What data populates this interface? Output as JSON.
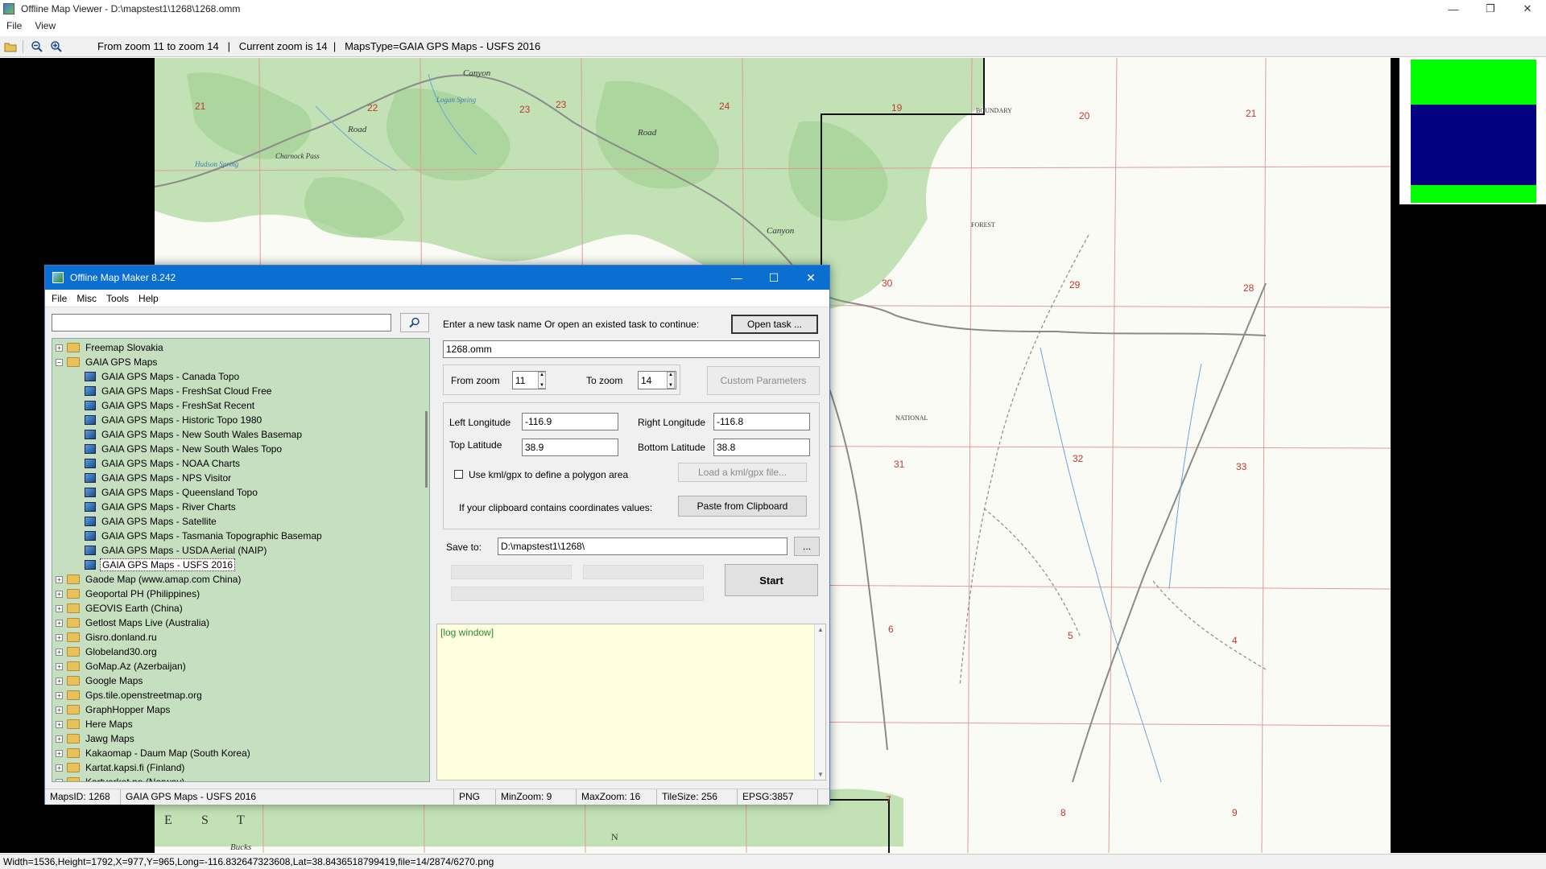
{
  "window": {
    "title": "Offline Map Viewer - D:\\mapstest1\\1268\\1268.omm",
    "controls": [
      "—",
      "❐",
      "✕"
    ]
  },
  "menubar": [
    "File",
    "View"
  ],
  "toolbar": {
    "status": "From zoom 11 to zoom 14   |   Current zoom is 14  |   MapsType=GAIA GPS Maps - USFS 2016"
  },
  "map": {
    "labels": [
      "21",
      "22",
      "23",
      "23",
      "24",
      "19",
      "20",
      "21",
      "30",
      "29",
      "28",
      "31",
      "32",
      "33",
      "6",
      "5",
      "4",
      "7",
      "8",
      "9"
    ],
    "place_labels": [
      "Canyon",
      "Road",
      "Road",
      "Canyon",
      "Charnock Pass",
      "Logan Spring",
      "Hudson Spring",
      "BOUNDARY",
      "NATIONAL",
      "FOREST",
      "Bucks",
      "E",
      "S",
      "T",
      "N"
    ]
  },
  "bottom_status": "Width=1536,Height=1792,X=977,Y=965,Long=-116.832647323608,Lat=38.8436518799419,file=14/2874/6270.png",
  "dialog": {
    "title": "Offline Map Maker 8.242",
    "menu": [
      "File",
      "Misc",
      "Tools",
      "Help"
    ],
    "search_value": "",
    "tree": [
      {
        "label": "Freemap Slovakia",
        "type": "folder",
        "expander": "+"
      },
      {
        "label": "GAIA GPS Maps",
        "type": "folder-open",
        "expander": "−"
      },
      {
        "label": "GAIA GPS Maps - Canada Topo",
        "type": "map"
      },
      {
        "label": "GAIA GPS Maps - FreshSat Cloud Free",
        "type": "map"
      },
      {
        "label": "GAIA GPS Maps - FreshSat Recent",
        "type": "map"
      },
      {
        "label": "GAIA GPS Maps - Historic Topo 1980",
        "type": "map"
      },
      {
        "label": "GAIA GPS Maps - New South Wales Basemap",
        "type": "map"
      },
      {
        "label": "GAIA GPS Maps - New South Wales Topo",
        "type": "map"
      },
      {
        "label": "GAIA GPS Maps - NOAA Charts",
        "type": "map"
      },
      {
        "label": "GAIA GPS Maps - NPS Visitor",
        "type": "map"
      },
      {
        "label": "GAIA GPS Maps - Queensland Topo",
        "type": "map"
      },
      {
        "label": "GAIA GPS Maps - River Charts",
        "type": "map"
      },
      {
        "label": "GAIA GPS Maps - Satellite",
        "type": "map"
      },
      {
        "label": "GAIA GPS Maps - Tasmania Topographic Basemap",
        "type": "map"
      },
      {
        "label": "GAIA GPS Maps - USDA Aerial (NAIP)",
        "type": "map"
      },
      {
        "label": "GAIA GPS Maps - USFS 2016",
        "type": "map",
        "selected": true
      },
      {
        "label": "Gaode Map (www.amap.com China)",
        "type": "folder",
        "expander": "+"
      },
      {
        "label": "Geoportal PH (Philippines)",
        "type": "folder",
        "expander": "+"
      },
      {
        "label": "GEOVIS Earth (China)",
        "type": "folder",
        "expander": "+"
      },
      {
        "label": "Getlost Maps Live (Australia)",
        "type": "folder",
        "expander": "+"
      },
      {
        "label": "Gisro.donland.ru",
        "type": "folder",
        "expander": "+"
      },
      {
        "label": "Globeland30.org",
        "type": "folder",
        "expander": "+"
      },
      {
        "label": "GoMap.Az (Azerbaijan)",
        "type": "folder",
        "expander": "+"
      },
      {
        "label": "Google Maps",
        "type": "folder",
        "expander": "+"
      },
      {
        "label": "Gps.tile.openstreetmap.org",
        "type": "folder",
        "expander": "+"
      },
      {
        "label": "GraphHopper Maps",
        "type": "folder",
        "expander": "+"
      },
      {
        "label": "Here Maps",
        "type": "folder",
        "expander": "+"
      },
      {
        "label": "Jawg Maps",
        "type": "folder",
        "expander": "+"
      },
      {
        "label": "Kakaomap - Daum Map (South Korea)",
        "type": "folder",
        "expander": "+"
      },
      {
        "label": "Kartat.kapsi.fi (Finland)",
        "type": "folder",
        "expander": "+"
      },
      {
        "label": "Kartverket.no (Norway)",
        "type": "folder",
        "expander": "+"
      }
    ],
    "task_prompt": "Enter a new task name Or open an existed task to continue:",
    "open_task_label": "Open task ...",
    "task_name": "1268.omm",
    "from_zoom_label": "From zoom",
    "from_zoom": "11",
    "to_zoom_label": "To zoom",
    "to_zoom": "14",
    "custom_params_label": "Custom Parameters",
    "left_lon_label": "Left Longitude",
    "left_lon": "-116.9",
    "right_lon_label": "Right Longitude",
    "right_lon": "-116.8",
    "top_lat_label": "Top Latitude",
    "top_lat": "38.9",
    "bottom_lat_label": "Bottom Latitude",
    "bottom_lat": "38.8",
    "kml_label": "Use kml/gpx to define a polygon area",
    "load_kml_label": "Load a kml/gpx file...",
    "clipboard_prompt": "If your clipboard contains coordinates values:",
    "paste_label": "Paste from Clipboard",
    "save_to_label": "Save to:",
    "save_to": "D:\\mapstest1\\1268\\",
    "browse_label": "...",
    "start_label": "Start",
    "log_text": "[log window]",
    "status": {
      "maps_id": "MapsID: 1268",
      "maps_type": "GAIA GPS Maps - USFS 2016",
      "format": "PNG",
      "min_zoom": "MinZoom: 9",
      "max_zoom": "MaxZoom: 16",
      "tile_size": "TileSize: 256",
      "epsg": "EPSG:3857"
    }
  }
}
